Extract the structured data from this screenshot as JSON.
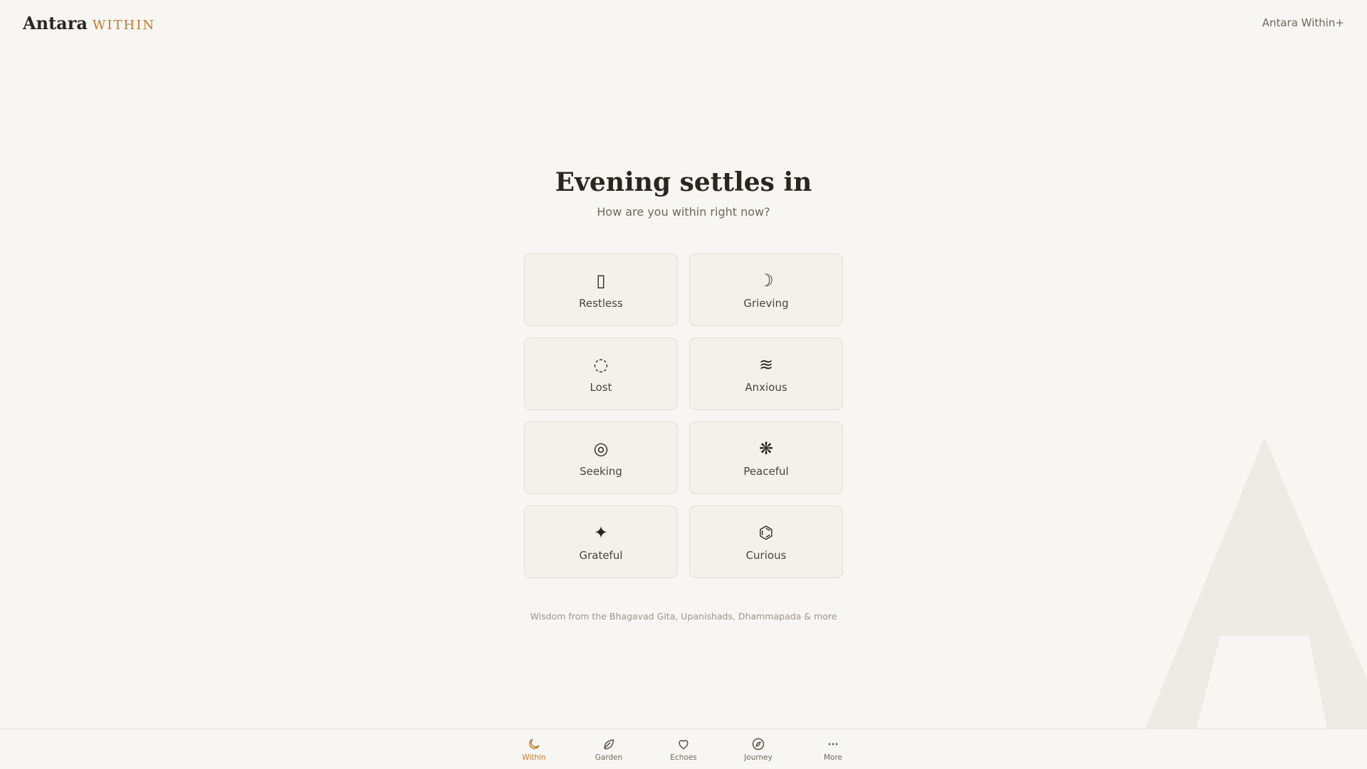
{
  "brand": {
    "name": "Antara",
    "sub": "WITHIN"
  },
  "header": {
    "upgrade_link": "Antara Within+"
  },
  "main": {
    "greeting": "Evening settles in",
    "question": "How are you within right now?",
    "moods": [
      {
        "label": "Restless",
        "icon": "▯",
        "icon_name": "restless-icon"
      },
      {
        "label": "Grieving",
        "icon": "☽",
        "icon_name": "crescent-moon-icon"
      },
      {
        "label": "Lost",
        "icon": "◌",
        "icon_name": "dotted-circle-icon"
      },
      {
        "label": "Anxious",
        "icon": "≋",
        "icon_name": "waves-icon"
      },
      {
        "label": "Seeking",
        "icon": "◎",
        "icon_name": "target-circle-icon"
      },
      {
        "label": "Peaceful",
        "icon": "❋",
        "icon_name": "flower-icon"
      },
      {
        "label": "Grateful",
        "icon": "✦",
        "icon_name": "sparkle-star-icon"
      },
      {
        "label": "Curious",
        "icon": "⌬",
        "icon_name": "hexagon-icon"
      }
    ],
    "wisdom": "Wisdom from the Bhagavad Gita, Upanishads, Dhammapada & more"
  },
  "nav": {
    "active": "Within",
    "items": [
      {
        "label": "Within",
        "icon_name": "moon-icon"
      },
      {
        "label": "Garden",
        "icon_name": "leaf-icon"
      },
      {
        "label": "Echoes",
        "icon_name": "heart-icon"
      },
      {
        "label": "Journey",
        "icon_name": "compass-icon"
      },
      {
        "label": "More",
        "icon_name": "more-dots-icon"
      }
    ]
  },
  "colors": {
    "background": "#f8f6f2",
    "accent": "#c07a2e",
    "text": "#2a2520",
    "muted": "#6e6860",
    "card": "#f4f1ec",
    "card_border": "#e3ded6"
  }
}
